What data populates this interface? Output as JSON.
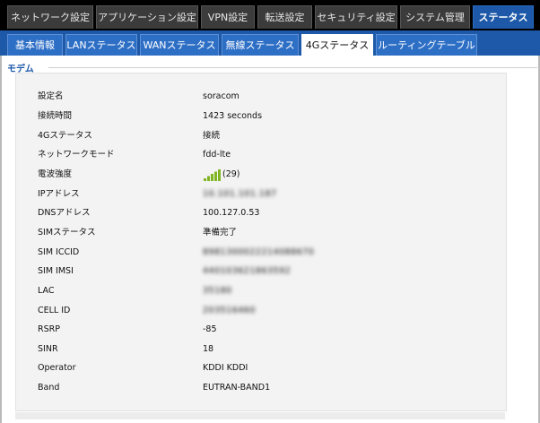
{
  "top_tabs": [
    {
      "label": "ネットワーク設定",
      "active": false
    },
    {
      "label": "アプリケーション設定",
      "active": false
    },
    {
      "label": "VPN設定",
      "active": false
    },
    {
      "label": "転送設定",
      "active": false
    },
    {
      "label": "セキュリティ設定",
      "active": false
    },
    {
      "label": "システム管理",
      "active": false
    },
    {
      "label": "ステータス",
      "active": true
    }
  ],
  "sub_tabs": [
    {
      "label": "基本情報",
      "active": false
    },
    {
      "label": "LANステータス",
      "active": false
    },
    {
      "label": "WANステータス",
      "active": false
    },
    {
      "label": "無線ステータス",
      "active": false
    },
    {
      "label": "4Gステータス",
      "active": true
    },
    {
      "label": "ルーティングテーブル",
      "active": false
    }
  ],
  "section": {
    "title": "モデム"
  },
  "modem": {
    "profile_name": {
      "label": "設定名",
      "value": "soracom"
    },
    "connection_time": {
      "label": "接続時間",
      "value": "1423 seconds"
    },
    "status_4g": {
      "label": "4Gステータス",
      "value": "接続"
    },
    "network_mode": {
      "label": "ネットワークモード",
      "value": "fdd-lte"
    },
    "signal": {
      "label": "電波強度",
      "value": "(29)",
      "level": 5,
      "max_level": 5,
      "color": "#7fb522"
    },
    "ip_address": {
      "label": "IPアドレス",
      "value": "10.101.101.187"
    },
    "dns_address": {
      "label": "DNSアドレス",
      "value": "100.127.0.53"
    },
    "sim_status": {
      "label": "SIMステータス",
      "value": "準備完了"
    },
    "sim_iccid": {
      "label": "SIM ICCID",
      "value": "8981300022214088670"
    },
    "sim_imsi": {
      "label": "SIM IMSI",
      "value": "440103621863592"
    },
    "lac": {
      "label": "LAC",
      "value": "35180"
    },
    "cell_id": {
      "label": "CELL ID",
      "value": "203516460"
    },
    "rsrp": {
      "label": "RSRP",
      "value": "-85"
    },
    "sinr": {
      "label": "SINR",
      "value": "18"
    },
    "operator": {
      "label": "Operator",
      "value": "KDDI KDDI"
    },
    "band": {
      "label": "Band",
      "value": "EUTRAN-BAND1"
    }
  },
  "colors": {
    "accent": "#1d59a8",
    "active_top_tab": "#1d59a8",
    "signal_green": "#7fb522"
  }
}
